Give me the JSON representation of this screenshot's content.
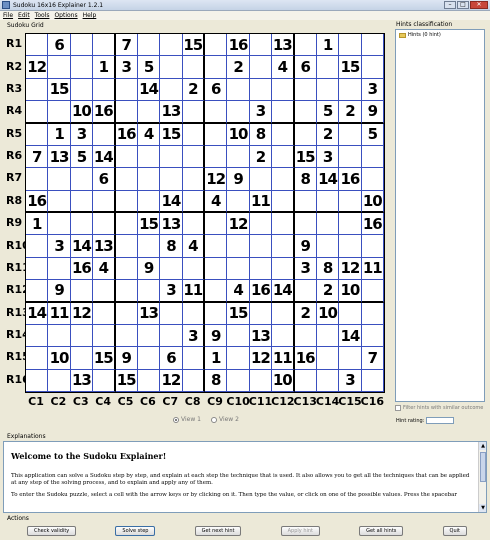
{
  "window": {
    "title": "Sudoku 16x16 Explainer 1.2.1"
  },
  "menu": [
    "File",
    "Edit",
    "Tools",
    "Options",
    "Help"
  ],
  "grid_panel": {
    "label": "Sudoku Grid",
    "row_labels": [
      "R1",
      "R2",
      "R3",
      "R4",
      "R5",
      "R6",
      "R7",
      "R8",
      "R9",
      "R10",
      "R11",
      "R12",
      "R13",
      "R14",
      "R15",
      "R16"
    ],
    "col_labels": [
      "C1",
      "C2",
      "C3",
      "C4",
      "C5",
      "C6",
      "C7",
      "C8",
      "C9",
      "C10",
      "C11",
      "C12",
      "C13",
      "C14",
      "C15",
      "C16"
    ],
    "values": [
      [
        "",
        "6",
        "",
        "",
        "7",
        "",
        "",
        "15",
        "",
        "16",
        "",
        "13",
        "",
        "1",
        "",
        ""
      ],
      [
        "12",
        "",
        "",
        "1",
        "3",
        "5",
        "",
        "",
        "",
        "2",
        "",
        "4",
        "6",
        "",
        "15",
        ""
      ],
      [
        "",
        "15",
        "",
        "",
        "",
        "14",
        "",
        "2",
        "6",
        "",
        "",
        "",
        "",
        "",
        "",
        "3"
      ],
      [
        "",
        "",
        "10",
        "16",
        "",
        "",
        "13",
        "",
        "",
        "",
        "3",
        "",
        "",
        "5",
        "2",
        "9"
      ],
      [
        "",
        "1",
        "3",
        "",
        "16",
        "4",
        "15",
        "",
        "",
        "10",
        "8",
        "",
        "",
        "2",
        "",
        "5"
      ],
      [
        "7",
        "13",
        "5",
        "14",
        "",
        "",
        "",
        "",
        "",
        "",
        "2",
        "",
        "15",
        "3",
        "",
        ""
      ],
      [
        "",
        "",
        "",
        "6",
        "",
        "",
        "",
        "",
        "12",
        "9",
        "",
        "",
        "8",
        "14",
        "16",
        ""
      ],
      [
        "16",
        "",
        "",
        "",
        "",
        "",
        "14",
        "",
        "4",
        "",
        "11",
        "",
        "",
        "",
        "",
        "10"
      ],
      [
        "1",
        "",
        "",
        "",
        "",
        "15",
        "13",
        "",
        "",
        "12",
        "",
        "",
        "",
        "",
        "",
        "16"
      ],
      [
        "",
        "3",
        "14",
        "13",
        "",
        "",
        "8",
        "4",
        "",
        "",
        "",
        "",
        "9",
        "",
        "",
        ""
      ],
      [
        "",
        "",
        "16",
        "4",
        "",
        "9",
        "",
        "",
        "",
        "",
        "",
        "",
        "3",
        "8",
        "12",
        "11"
      ],
      [
        "",
        "9",
        "",
        "",
        "",
        "",
        "3",
        "11",
        "",
        "4",
        "16",
        "14",
        "",
        "2",
        "10",
        ""
      ],
      [
        "14",
        "11",
        "12",
        "",
        "",
        "13",
        "",
        "",
        "",
        "15",
        "",
        "",
        "2",
        "10",
        "",
        ""
      ],
      [
        "",
        "",
        "",
        "",
        "",
        "",
        "",
        "3",
        "9",
        "",
        "13",
        "",
        "",
        "",
        "14",
        ""
      ],
      [
        "",
        "10",
        "",
        "15",
        "9",
        "",
        "6",
        "",
        "1",
        "",
        "12",
        "11",
        "16",
        "",
        "",
        "7"
      ],
      [
        "",
        "",
        "13",
        "",
        "15",
        "",
        "12",
        "",
        "8",
        "",
        "",
        "10",
        "",
        "",
        "3",
        ""
      ]
    ],
    "view_options": {
      "view1": "View 1",
      "view2": "View 2"
    }
  },
  "hints_panel": {
    "label": "Hints classification",
    "root_node": "Hints (0 hint)",
    "filter_label": "Filter hints with similar outcome",
    "rating_label": "Hint rating:"
  },
  "explanations": {
    "label": "Explanations",
    "heading": "Welcome to the Sudoku Explainer!",
    "p1": "This application can solve a Sudoku step by step, and explain at each step the technique that is used. It also allows you to get all the techniques that can be applied at any step of the solving process, and to explain and apply any of them.",
    "p2": "To enter the Sudoku puzzle, select a cell with the arrow keys or by clicking on it. Then type the value, or click on one of the possible values. Press the spacebar"
  },
  "actions": {
    "label": "Actions",
    "check_validity": "Check validity",
    "solve_step": "Solve step",
    "get_next_hint": "Get next hint",
    "apply_hint": "Apply hint",
    "get_all_hints": "Get all hints",
    "quit": "Quit"
  }
}
